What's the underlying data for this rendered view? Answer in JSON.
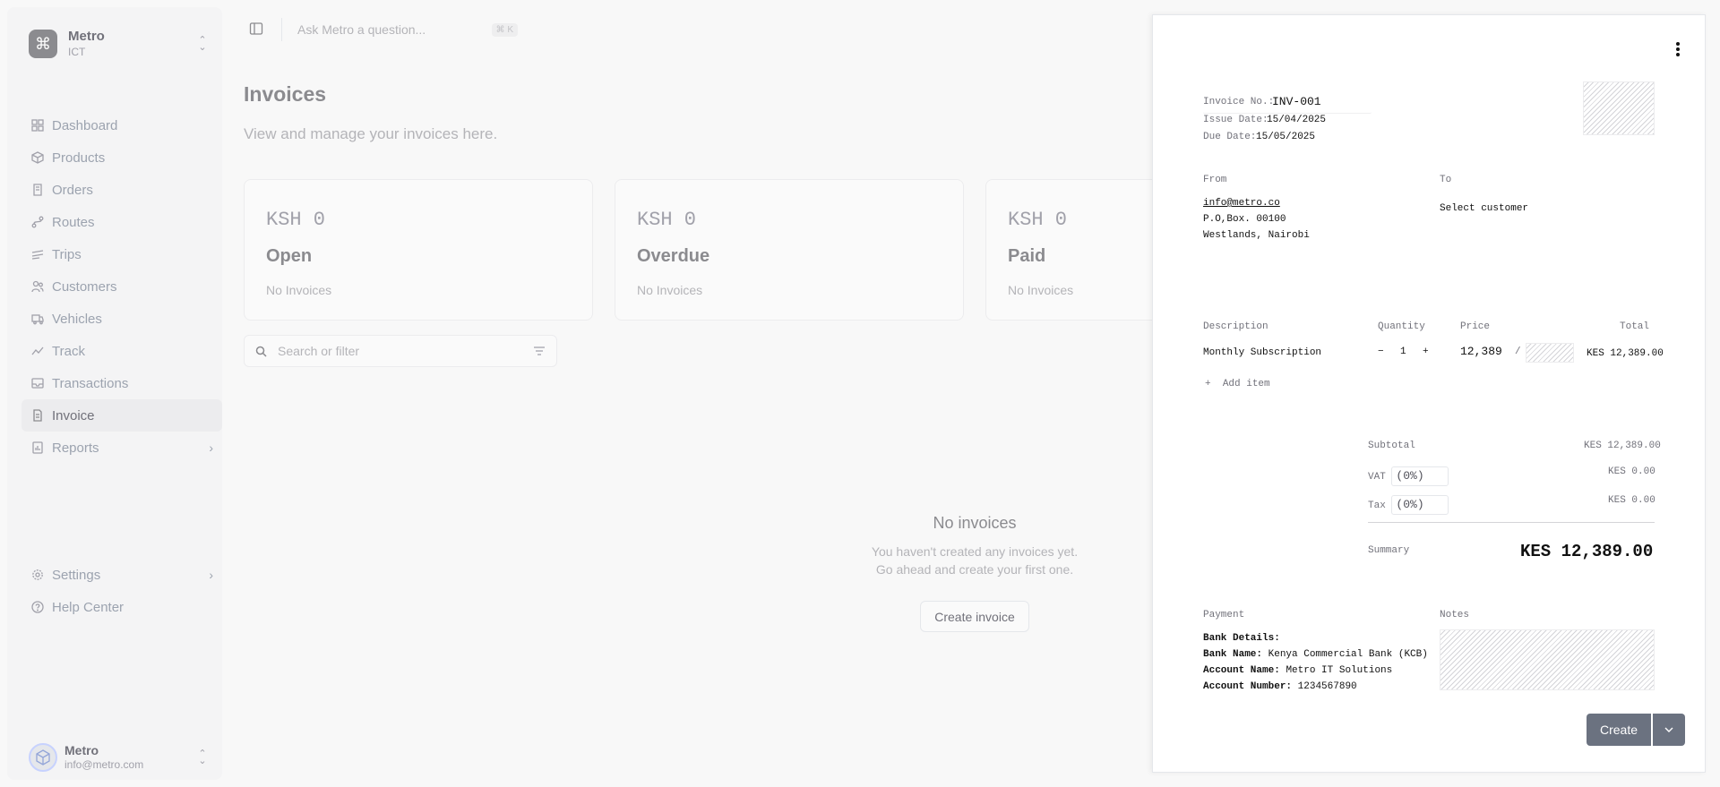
{
  "workspace": {
    "name": "Metro",
    "sub": "ICT"
  },
  "sidebar": {
    "items": [
      {
        "label": "Dashboard",
        "icon": "dashboard-icon"
      },
      {
        "label": "Products",
        "icon": "products-icon"
      },
      {
        "label": "Orders",
        "icon": "orders-icon"
      },
      {
        "label": "Routes",
        "icon": "routes-icon"
      },
      {
        "label": "Trips",
        "icon": "trips-icon"
      },
      {
        "label": "Customers",
        "icon": "customers-icon"
      },
      {
        "label": "Vehicles",
        "icon": "vehicles-icon"
      },
      {
        "label": "Track",
        "icon": "track-icon"
      },
      {
        "label": "Transactions",
        "icon": "transactions-icon"
      },
      {
        "label": "Invoice",
        "icon": "invoice-icon",
        "active": true
      },
      {
        "label": "Reports",
        "icon": "reports-icon",
        "has_submenu": true
      }
    ],
    "bottom": [
      {
        "label": "Settings",
        "icon": "settings-icon",
        "has_submenu": true
      },
      {
        "label": "Help Center",
        "icon": "help-icon"
      }
    ]
  },
  "user": {
    "name": "Metro",
    "email": "info@metro.com"
  },
  "topbar": {
    "ask_placeholder": "Ask Metro a question...",
    "shortcut": "⌘ K"
  },
  "main": {
    "title": "Invoices",
    "subtitle": "View and manage your invoices here.",
    "cards": [
      {
        "amount": "KSH 0",
        "title": "Open",
        "sub": "No Invoices"
      },
      {
        "amount": "KSH 0",
        "title": "Overdue",
        "sub": "No Invoices"
      },
      {
        "amount": "KSH 0",
        "title": "Paid",
        "sub": "No Invoices"
      }
    ],
    "search_placeholder": "Search or filter",
    "empty": {
      "title": "No invoices",
      "line1": "You haven't created any invoices yet.",
      "line2": "Go ahead and create your first one.",
      "button": "Create invoice"
    }
  },
  "invoice": {
    "invoice_no_label": "Invoice No.:",
    "invoice_no": "INV-001",
    "issue_label": "Issue Date:",
    "issue_date": "15/04/2025",
    "due_label": "Due Date:",
    "due_date": "15/05/2025",
    "from_label": "From",
    "from_email": "info@metro.co",
    "from_line2": "P.O,Box. 00100",
    "from_line3": "Westlands, Nairobi",
    "to_label": "To",
    "to_value": "Select customer",
    "columns": {
      "description": "Description",
      "quantity": "Quantity",
      "price": "Price",
      "total": "Total"
    },
    "line_item": {
      "description": "Monthly Subscription",
      "minus": "−",
      "qty": "1",
      "plus": "+",
      "price": "12,389",
      "slash": "/",
      "total": "KES 12,389.00"
    },
    "add_item": "Add item",
    "subtotal_label": "Subtotal",
    "subtotal": "KES 12,389.00",
    "vat_label": "VAT",
    "vat_pct": "(0%)",
    "vat": "KES 0.00",
    "tax_label": "Tax",
    "tax_pct": "(0%)",
    "tax": "KES 0.00",
    "summary_label": "Summary",
    "summary": "KES 12,389.00",
    "payment_label": "Payment",
    "bank_details_label": "Bank Details:",
    "bank_name_label": "Bank Name:",
    "bank_name": "Kenya Commercial Bank (KCB)",
    "account_name_label": "Account Name:",
    "account_name": "Metro IT Solutions",
    "account_number_label": "Account Number:",
    "account_number": "1234567890",
    "notes_label": "Notes",
    "create_button": "Create"
  }
}
